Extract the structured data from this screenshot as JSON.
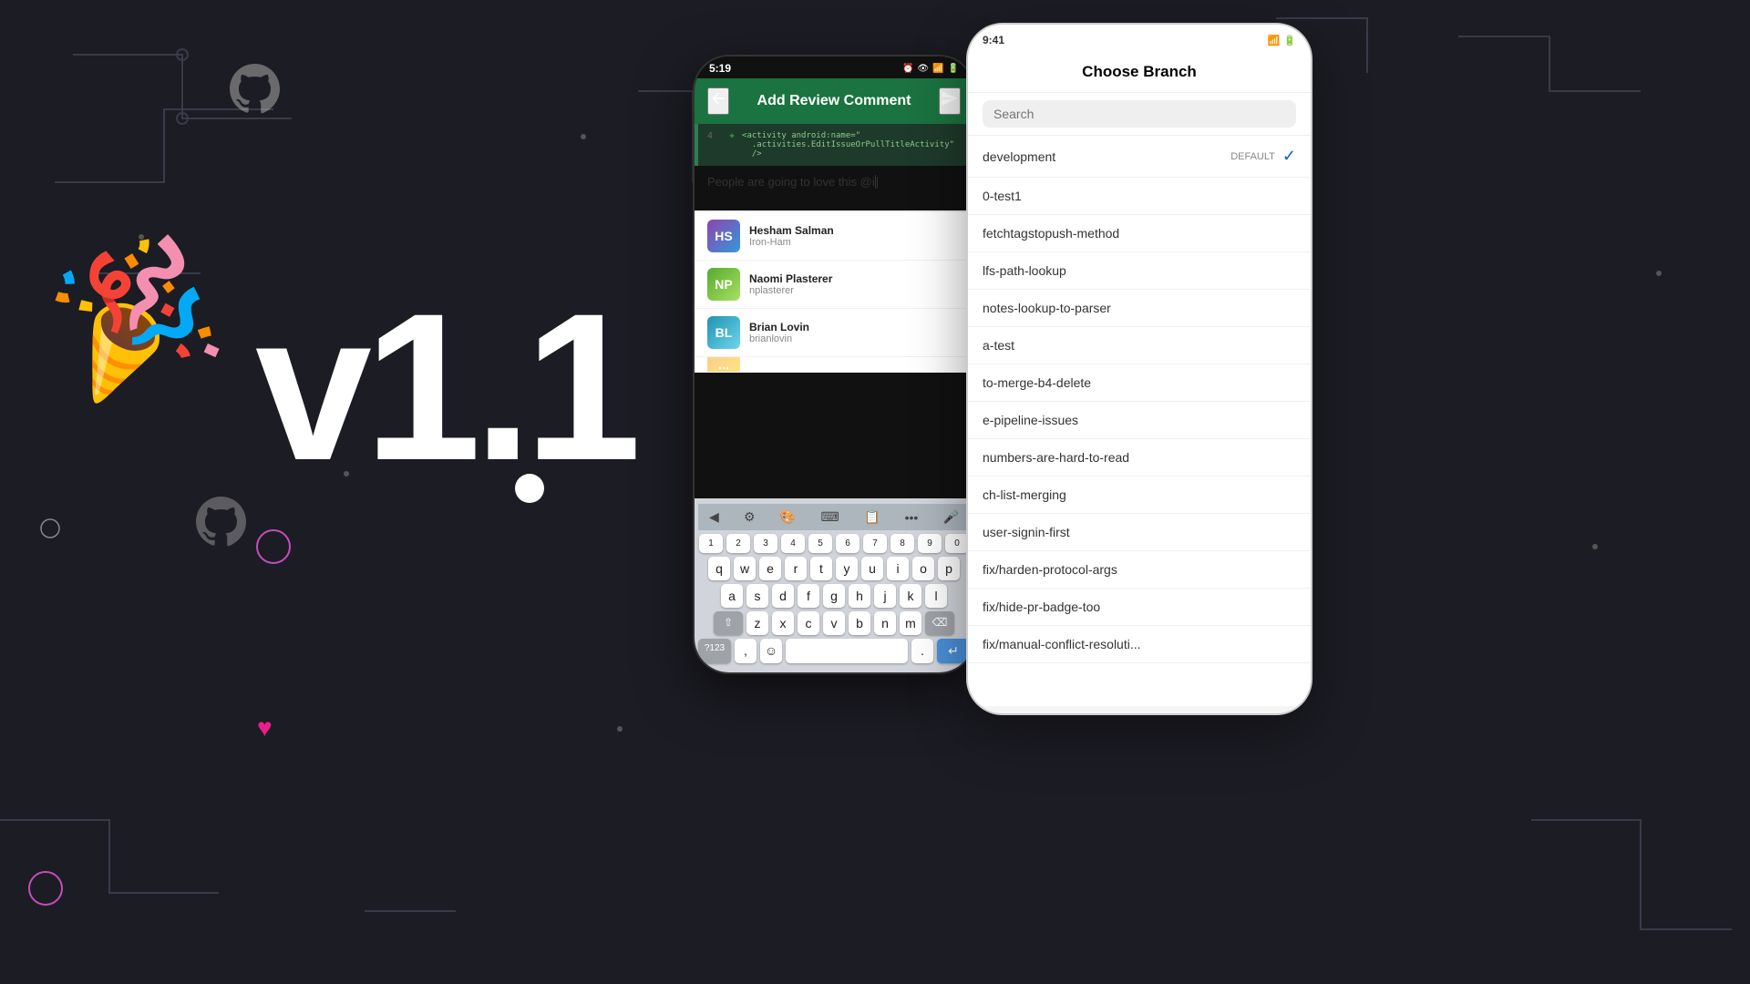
{
  "background": {
    "color": "#1c1c24"
  },
  "left_section": {
    "version": "v1.1",
    "emoji_popper": "🎉"
  },
  "phone_screen": {
    "status_bar": {
      "time": "5:19",
      "icons": "⏰ 👁 📶 🔋"
    },
    "header": {
      "title": "Add Review Comment",
      "back_icon": "←",
      "send_icon": "→"
    },
    "code_diff": {
      "line_number": "4",
      "line_indicator": "+",
      "code": "<activity android:name=\".activities.EditIssueOrPullTitleActivity\"/>"
    },
    "comment_text": "People are going to love this @i",
    "mentions": [
      {
        "name": "Hesham Salman",
        "handle": "Iron-Ham",
        "avatar_color": "purple",
        "initials": "HS"
      },
      {
        "name": "Naomi Plasterer",
        "handle": "nplasterer",
        "avatar_color": "green",
        "initials": "NP"
      },
      {
        "name": "Brian Lovin",
        "handle": "brianlovin",
        "avatar_color": "blue",
        "initials": "BL"
      }
    ],
    "keyboard": {
      "toolbar_buttons": [
        "←",
        "⚙",
        "🎨",
        "⌨",
        "📋",
        "•••",
        "🎤"
      ],
      "row1": [
        "q",
        "w",
        "e",
        "r",
        "t",
        "y",
        "u",
        "i",
        "o",
        "p"
      ],
      "row2": [
        "a",
        "s",
        "d",
        "f",
        "g",
        "h",
        "j",
        "k",
        "l"
      ],
      "row3": [
        "z",
        "x",
        "c",
        "v",
        "b",
        "n",
        "m"
      ],
      "bottom": {
        "num_sym": "?123",
        "comma": ",",
        "emoji": "☺",
        "space": "",
        "period": ".",
        "return": "↵"
      }
    }
  },
  "branch_panel": {
    "status_bar": {
      "time": "9:41",
      "right_icons": "📶 🔋"
    },
    "title": "Choose Branch",
    "search_placeholder": "Search",
    "branches": [
      {
        "name": "development",
        "badge": "DEFAULT",
        "selected": true
      },
      {
        "name": "0-test1",
        "badge": "",
        "selected": false
      },
      {
        "name": "fetchtagstopush-method",
        "badge": "",
        "selected": false
      },
      {
        "name": "lfs-path-lookup",
        "badge": "",
        "selected": false
      },
      {
        "name": "notes-lookup-to-parser",
        "badge": "",
        "selected": false
      },
      {
        "name": "a-test",
        "badge": "",
        "selected": false
      },
      {
        "name": "to-merge-b4-delete",
        "badge": "",
        "selected": false
      },
      {
        "name": "e-pipeline-issues",
        "badge": "",
        "selected": false
      },
      {
        "name": "numbers-are-hard-to-read",
        "badge": "",
        "selected": false
      },
      {
        "name": "ch-list-merging",
        "badge": "",
        "selected": false
      },
      {
        "name": "user-signin-first",
        "badge": "",
        "selected": false
      },
      {
        "name": "fix/harden-protocol-args",
        "badge": "",
        "selected": false
      },
      {
        "name": "fix/hide-pr-badge-too",
        "badge": "",
        "selected": false
      },
      {
        "name": "fix/manual-conflict-resoluti...",
        "badge": "",
        "selected": false
      }
    ]
  }
}
